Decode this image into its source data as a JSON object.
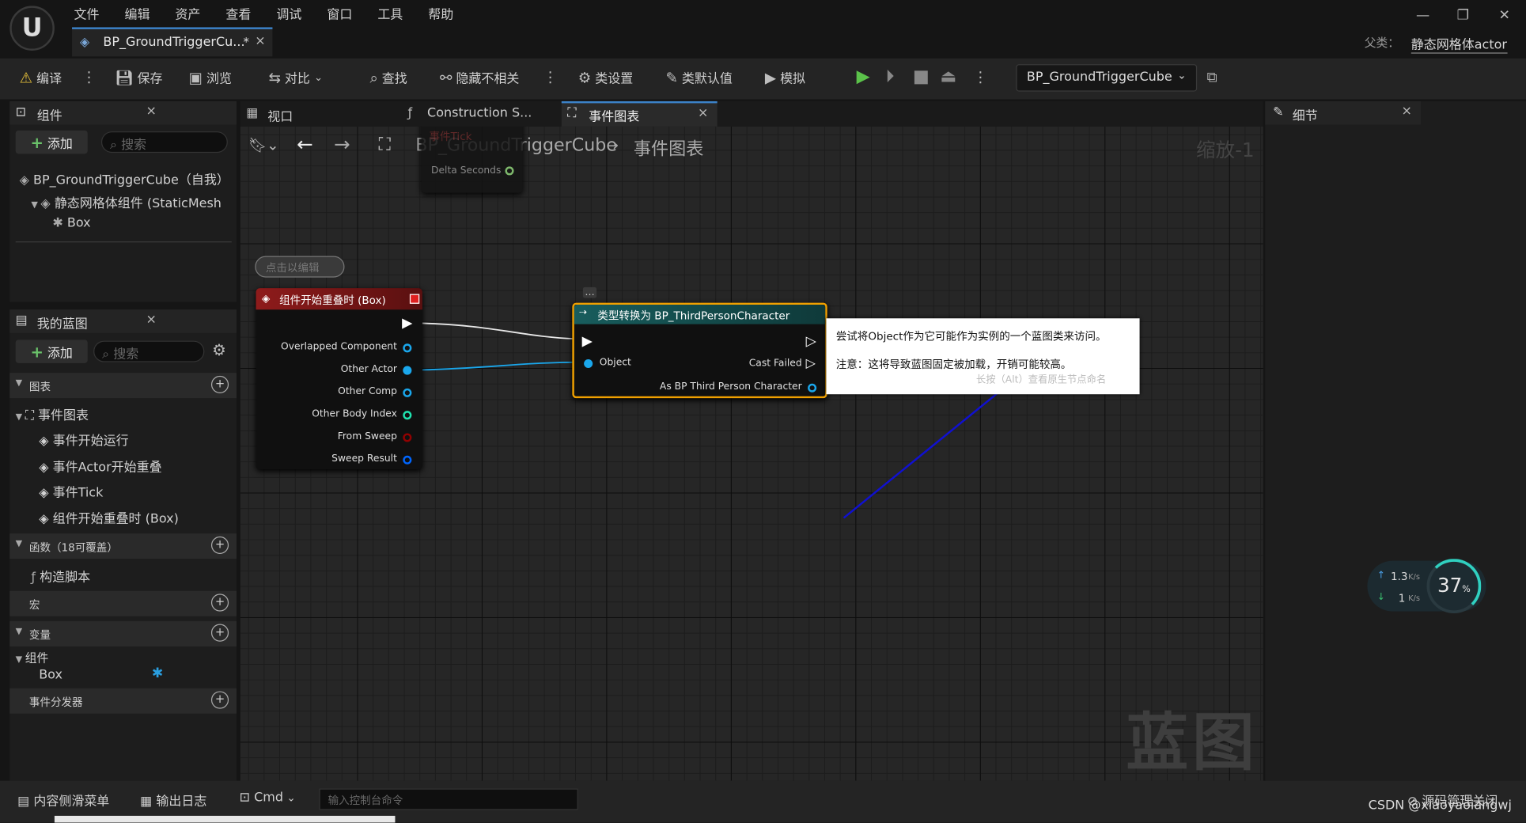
{
  "menu": [
    "文件",
    "编辑",
    "资产",
    "查看",
    "调试",
    "窗口",
    "工具",
    "帮助"
  ],
  "doc_tab": {
    "label": "BP_GroundTriggerCu...",
    "modified": "*",
    "close": "×"
  },
  "window": {
    "minimize": "—",
    "restore": "❐",
    "close": "✕"
  },
  "parent": {
    "label": "父类：",
    "value": "静态网格体actor"
  },
  "toolbar": {
    "compile": "编译",
    "save": "保存",
    "browse": "浏览",
    "diff": "对比",
    "find": "查找",
    "hide_unrelated": "隐藏不相关",
    "class_settings": "类设置",
    "class_defaults": "类默认值",
    "simulate": "模拟",
    "debug_object": "BP_GroundTriggerCube"
  },
  "components_panel": {
    "title": "组件",
    "close": "×",
    "add": "添加",
    "search_placeholder": "搜索",
    "tree": [
      "BP_GroundTriggerCube（自我）",
      "静态网格体组件 (StaticMesh",
      "Box"
    ]
  },
  "my_blueprint": {
    "title": "我的蓝图",
    "close": "×",
    "add": "添加",
    "search_placeholder": "搜索",
    "graphs_section": "图表",
    "event_graph": "事件图表",
    "events": [
      "事件开始运行",
      "事件Actor开始重叠",
      "事件Tick",
      "组件开始重叠时 (Box)"
    ],
    "functions_section": "函数（18可覆盖）",
    "construction_script": "构造脚本",
    "macros_section": "宏",
    "variables_section": "变量",
    "components_group": "组件",
    "box_var": "Box",
    "dispatchers_section": "事件分发器"
  },
  "editor_tabs": [
    "视口",
    "Construction S...",
    "事件图表"
  ],
  "editor_tab_close": "×",
  "breadcrumb": {
    "blueprint": "BP_GroundTriggerCube",
    "graph": "事件图表",
    "zoom": "缩放-1"
  },
  "graph": {
    "tick_node": {
      "title": "事件Tick",
      "pin": "Delta Seconds"
    },
    "comment_bubble": "点击以编辑",
    "overlap_node": {
      "title": "组件开始重叠时 (Box)",
      "pins": [
        "Overlapped Component",
        "Other Actor",
        "Other Comp",
        "Other Body Index",
        "From Sweep",
        "Sweep Result"
      ]
    },
    "cast_node": {
      "title": "类型转换为 BP_ThirdPersonCharacter",
      "input": "Object",
      "cast_failed": "Cast Failed",
      "output": "As BP Third Person Character"
    },
    "tooltip": {
      "line1": "尝试将Object作为它可能作为实例的一个蓝图类来访问。",
      "line2": "注意：这将导致蓝图固定被加载，开销可能较高。",
      "hint": "长按（Alt）查看原生节点命名"
    },
    "watermark": "蓝图"
  },
  "details_panel": {
    "title": "细节",
    "close": "×"
  },
  "net_widget": {
    "up": "1.3",
    "up_unit": "K/s",
    "down": "1",
    "down_unit": "K/s",
    "percent": "37",
    "percent_unit": "%"
  },
  "bottom": {
    "content_drawer": "内容侧滑菜单",
    "output_log": "输出日志",
    "cmd": "Cmd",
    "console_placeholder": "输入控制台命令",
    "source_control": "源码管理关闭",
    "credit": "CSDN @xiaoyaoiangwj"
  },
  "colors": {
    "exec_white": "#ffffff",
    "object_pin": "#1aa7ec",
    "int_pin": "#1fe3af",
    "bool_pin": "#920101",
    "struct_pin": "#0066ff",
    "event_header": "#8e1b1b",
    "cast_header": "#185d5d",
    "selected_outline": "#f0a000"
  }
}
